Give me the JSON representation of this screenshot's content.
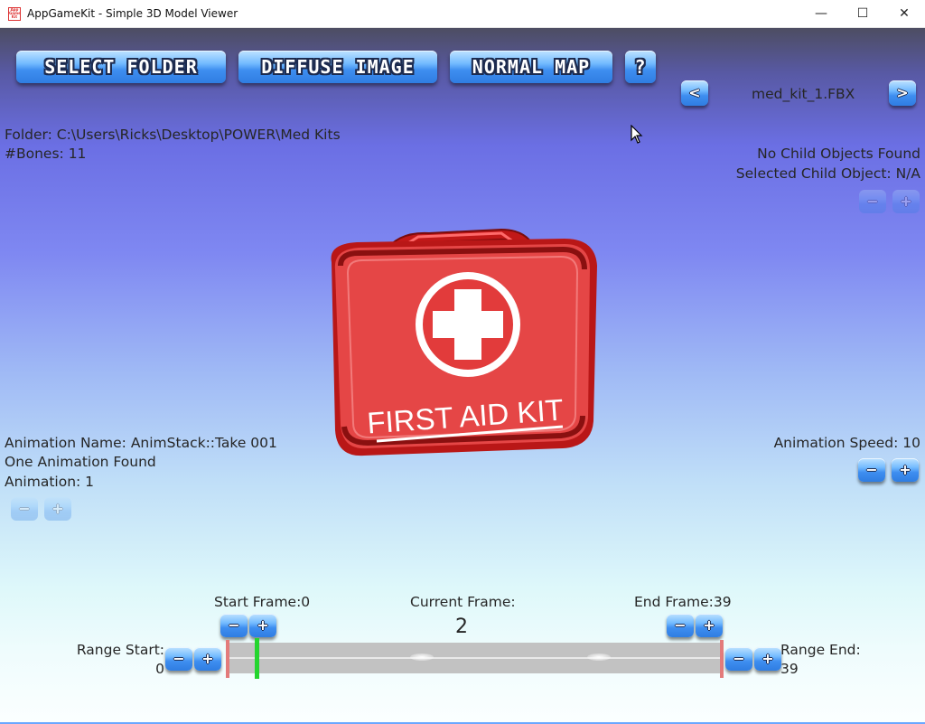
{
  "window": {
    "title": "AppGameKit - Simple 3D Model Viewer",
    "icon_text": "App Game Kit"
  },
  "toolbar": {
    "select_folder": "SELECT FOLDER",
    "diffuse_image": "DIFFUSE IMAGE",
    "normal_map": "NORMAL MAP",
    "help": "?",
    "prev": "<",
    "next": ">",
    "model_name": "med_kit_1.FBX"
  },
  "info": {
    "folder": "Folder: C:\\Users\\Ricks\\Desktop\\POWER\\Med Kits",
    "bones": "#Bones: 11",
    "child_objects": "No Child Objects Found",
    "selected_child": "Selected Child Object: N/A"
  },
  "animation": {
    "name": "Animation Name: AnimStack::Take 001",
    "found": "One Animation Found",
    "index": "Animation: 1",
    "speed": "Animation Speed: 10"
  },
  "model": {
    "label": "FIRST AID KIT"
  },
  "frames": {
    "start_label": "Start Frame:0",
    "current_label": "Current Frame:",
    "current_value": "2",
    "end_label": "End Frame:39",
    "range_start_label": "Range Start:",
    "range_start_value": "0",
    "range_end_label": "Range End:",
    "range_end_value": "39",
    "total_frames": 39,
    "current_frame": 2
  },
  "buttons": {
    "minus": "−",
    "plus": "+"
  }
}
